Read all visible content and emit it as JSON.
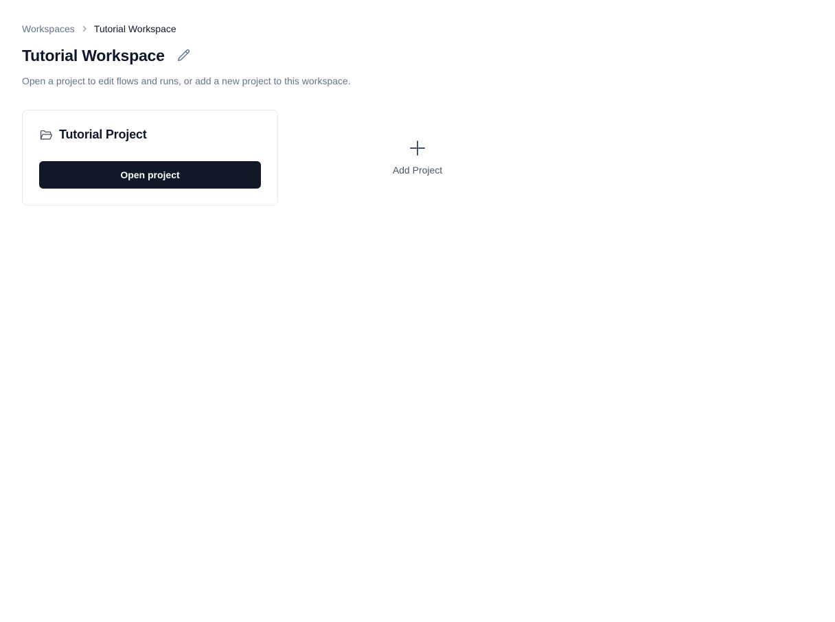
{
  "breadcrumb": {
    "items": [
      "Workspaces",
      "Tutorial Workspace"
    ]
  },
  "header": {
    "title": "Tutorial Workspace",
    "subtitle": "Open a project to edit flows and runs, or add a new project to this workspace."
  },
  "projects": [
    {
      "name": "Tutorial Project",
      "action_label": "Open project"
    }
  ],
  "add_project": {
    "label": "Add Project"
  },
  "icons": {
    "chevron": "chevron-right-icon",
    "edit": "pencil-icon",
    "folder": "folder-open-icon",
    "add": "plus-icon"
  },
  "colors": {
    "primary_button": "#111827",
    "muted_text": "#64748b",
    "border": "#e2e8f0"
  }
}
